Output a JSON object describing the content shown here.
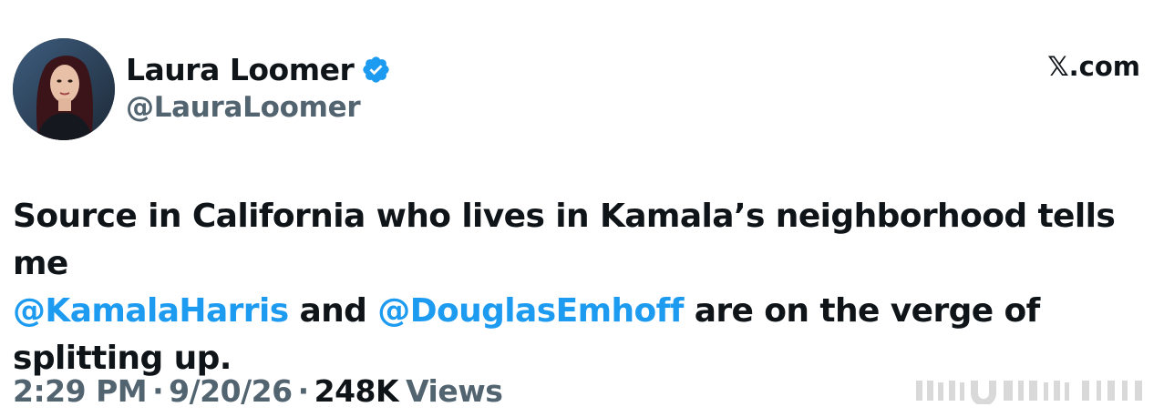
{
  "author": {
    "display_name": "Laura Loomer",
    "handle": "@LauraLoomer",
    "verified_icon": "verified-badge-icon",
    "avatar": "profile-photo"
  },
  "site": {
    "label": "𝕏.com",
    "suffix": ".com",
    "logo_icon": "x-logo-icon"
  },
  "tweet": {
    "line1": "Source in California who lives in Kamala’s neighborhood tells me",
    "mention1": "@KamalaHarris",
    "connector": " and ",
    "mention2": "@DouglasEmhoff",
    "tail": " are on the verge of splitting up."
  },
  "meta": {
    "time": "2:29 PM",
    "sep1": "·",
    "date": "9/20/26",
    "sep2": "·",
    "views_count": "248K",
    "views_label": "Views"
  },
  "colors": {
    "mention": "#1d9bf0",
    "secondary_text": "#536471",
    "primary_text": "#0f1419",
    "verified": "#1d9bf0"
  }
}
